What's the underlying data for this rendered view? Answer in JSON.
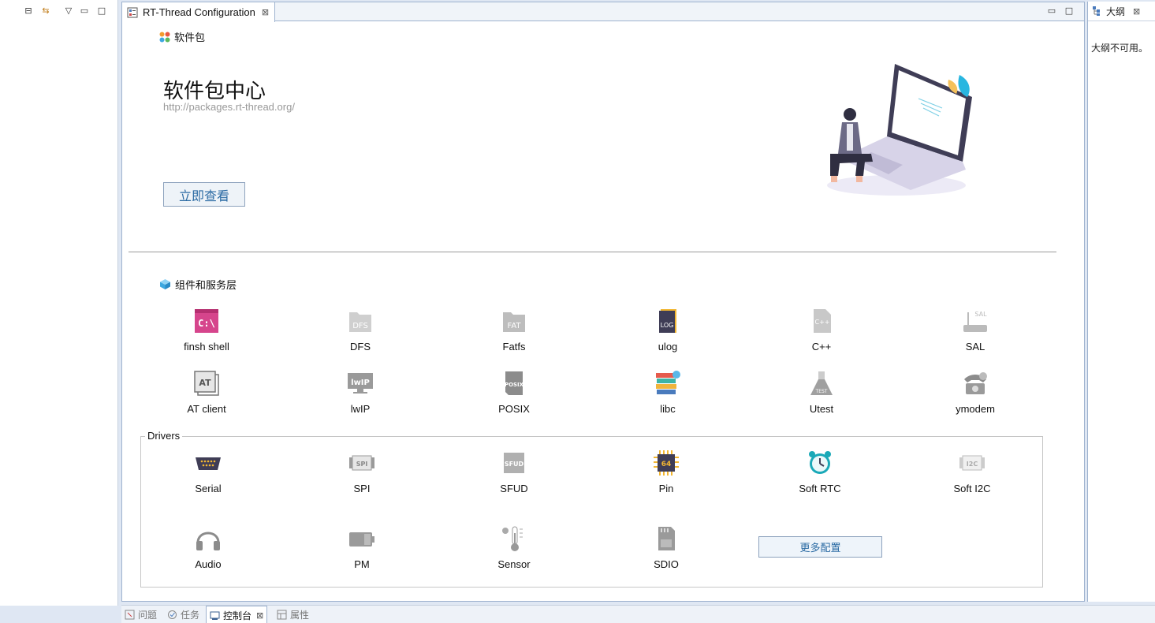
{
  "editor": {
    "tab_title": "RT-Thread Configuration",
    "tab_close": "⊠",
    "minimize": "▭",
    "maximize": "□"
  },
  "left_toolbar": {
    "collapse_all": "⊟",
    "link": "⇆",
    "menu": "▽",
    "minimize": "▭",
    "maximize": "□"
  },
  "packages": {
    "section_title": "软件包",
    "center_title": "软件包中心",
    "center_url": "http://packages.rt-thread.org/",
    "view_button": "立即查看"
  },
  "components": {
    "section_title": "组件和服务层",
    "items": [
      {
        "label": "finsh shell",
        "icon": "cmd-terminal-icon"
      },
      {
        "label": "DFS",
        "icon": "folder-dfs-icon"
      },
      {
        "label": "Fatfs",
        "icon": "folder-fat-icon"
      },
      {
        "label": "ulog",
        "icon": "log-book-icon"
      },
      {
        "label": "C++",
        "icon": "cpp-file-icon"
      },
      {
        "label": "SAL",
        "icon": "router-sal-icon"
      },
      {
        "label": "AT client",
        "icon": "at-command-icon"
      },
      {
        "label": "lwIP",
        "icon": "lwip-monitor-icon"
      },
      {
        "label": "POSIX",
        "icon": "posix-file-icon"
      },
      {
        "label": "libc",
        "icon": "books-icon"
      },
      {
        "label": "Utest",
        "icon": "test-flask-icon"
      },
      {
        "label": "ymodem",
        "icon": "telephone-icon"
      }
    ]
  },
  "drivers": {
    "group_label": "Drivers",
    "items": [
      {
        "label": "Serial",
        "icon": "serial-port-icon"
      },
      {
        "label": "SPI",
        "icon": "spi-chip-icon"
      },
      {
        "label": "SFUD",
        "icon": "sfud-chip-icon"
      },
      {
        "label": "Pin",
        "icon": "pin-chip-icon"
      },
      {
        "label": "Soft RTC",
        "icon": "alarm-clock-icon"
      },
      {
        "label": "Soft I2C",
        "icon": "i2c-chip-icon"
      },
      {
        "label": "Audio",
        "icon": "headphones-icon"
      },
      {
        "label": "PM",
        "icon": "battery-icon"
      },
      {
        "label": "Sensor",
        "icon": "thermometer-icon"
      },
      {
        "label": "SDIO",
        "icon": "sd-card-icon"
      }
    ],
    "more_button": "更多配置"
  },
  "collapse_button": "«",
  "outline": {
    "tab_title": "大纲",
    "tab_close": "⊠",
    "message": "大纲不可用。"
  },
  "bottom_tabs": [
    {
      "label": "问题",
      "icon": "problems-icon"
    },
    {
      "label": "任务",
      "icon": "tasks-icon"
    },
    {
      "label": "控制台",
      "icon": "console-icon"
    },
    {
      "label": "属性",
      "icon": "properties-icon"
    }
  ],
  "bottom_close": "⊠",
  "colors": {
    "accent_blue": "#2a6aa3",
    "frame_border": "#9fb3cf",
    "background": "#dfe7f3"
  }
}
